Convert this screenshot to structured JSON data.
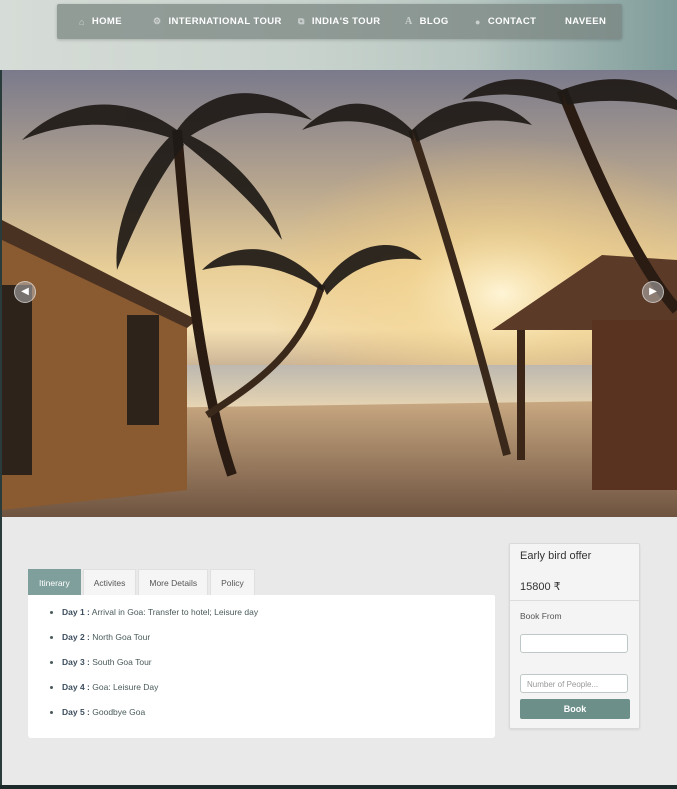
{
  "nav": {
    "items": [
      {
        "label": "HOME",
        "icon": "home-icon"
      },
      {
        "label": "INTERNATIONAL TOUR",
        "icon": "gears-icon"
      },
      {
        "label": "INDIA'S TOUR",
        "icon": "copy-icon"
      },
      {
        "label": "BLOG",
        "icon": "font-icon"
      },
      {
        "label": "CONTACT",
        "icon": "chat-icon"
      },
      {
        "label": "NAVEEN",
        "icon": ""
      }
    ]
  },
  "hero": {
    "prev_icon": "chevron-left-icon",
    "next_icon": "chevron-right-icon"
  },
  "tabs": [
    {
      "label": "Itinerary",
      "active": true
    },
    {
      "label": "Activites",
      "active": false
    },
    {
      "label": "More Details",
      "active": false
    },
    {
      "label": "Policy",
      "active": false
    }
  ],
  "itinerary": [
    {
      "day": "Day 1 :",
      "text": "Arrival in Goa: Transfer to hotel; Leisure day"
    },
    {
      "day": "Day 2 :",
      "text": "North Goa Tour"
    },
    {
      "day": "Day 3 :",
      "text": "South Goa Tour"
    },
    {
      "day": "Day 4 :",
      "text": "Goa: Leisure Day"
    },
    {
      "day": "Day 5 :",
      "text": "Goodbye Goa"
    }
  ],
  "offer": {
    "title": "Early bird offer",
    "price": "15800 ₹",
    "book_from_label": "Book From",
    "date_value": "",
    "people_placeholder": "Number of People...",
    "book_button": "Book"
  },
  "colors": {
    "accent": "#7f9f9c",
    "button": "#6c8f8a"
  }
}
